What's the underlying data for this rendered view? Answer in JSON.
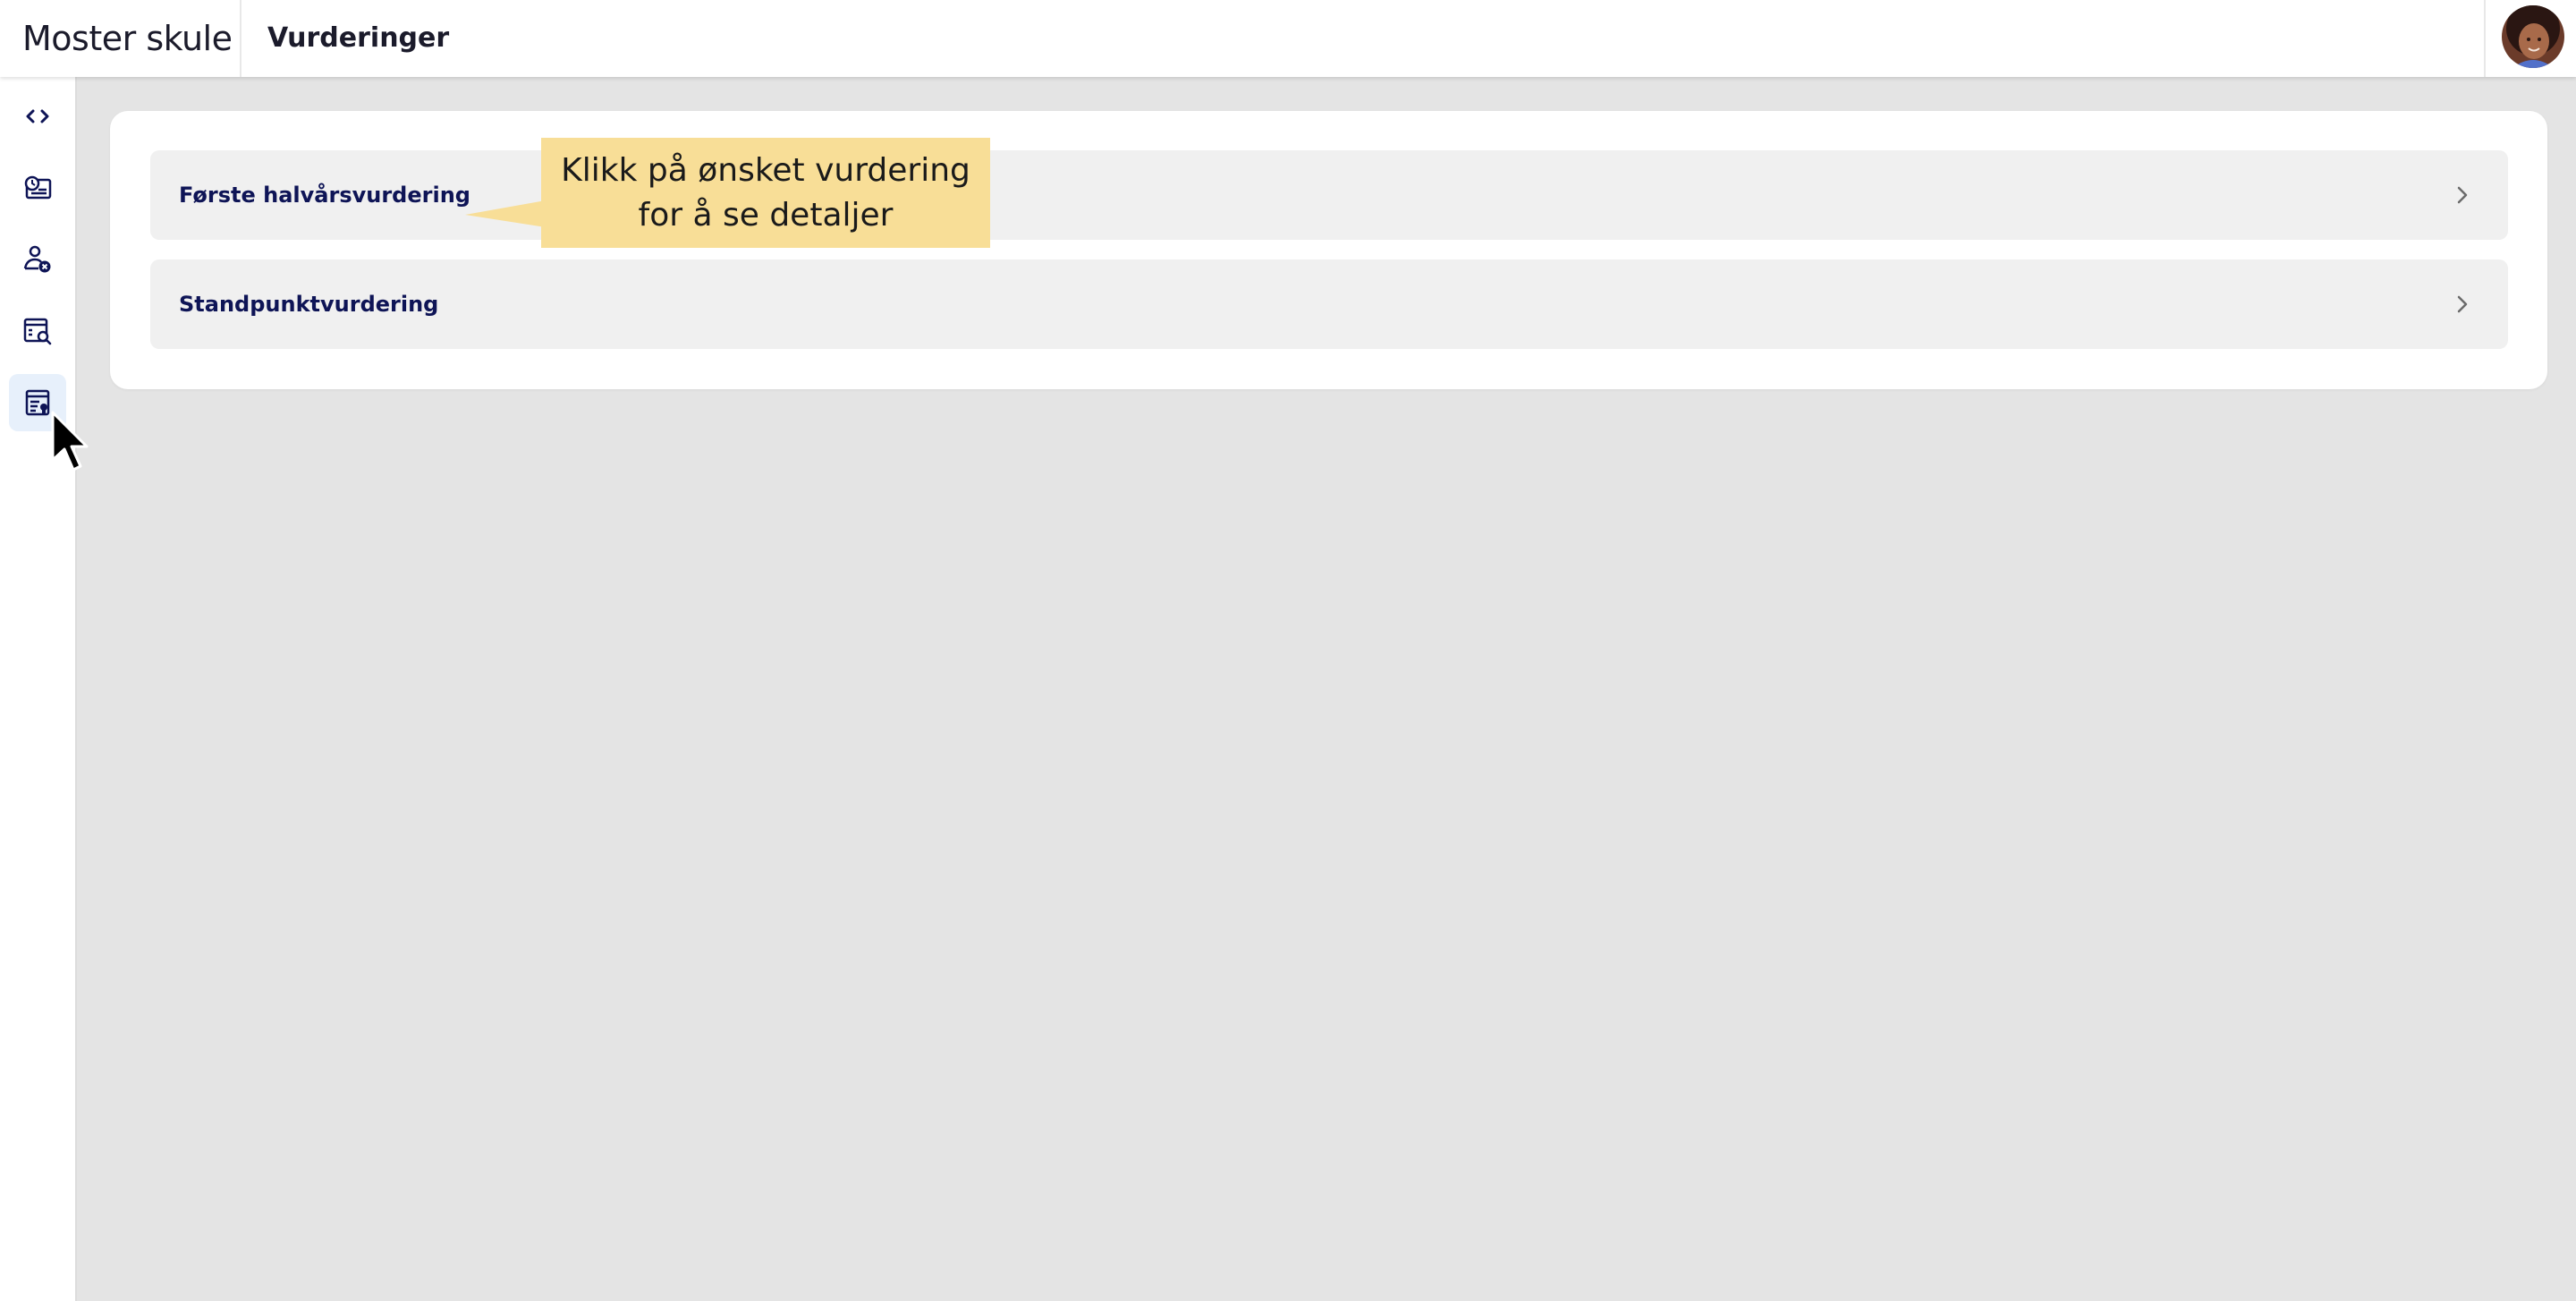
{
  "header": {
    "brand": "Moster skule",
    "title": "Vurderinger"
  },
  "sidebar": {
    "items": [
      {
        "icon": "expand-collapse-icon"
      },
      {
        "icon": "dashboard-icon"
      },
      {
        "icon": "user-absence-icon"
      },
      {
        "icon": "search-report-icon"
      },
      {
        "icon": "assessment-certificate-icon",
        "active": true
      }
    ]
  },
  "assessments": [
    {
      "label": "Første halvårsvurdering"
    },
    {
      "label": "Standpunktvurdering"
    }
  ],
  "callout": {
    "line1": "Klikk på ønsket vurdering",
    "line2": "for å se detaljer"
  },
  "colors": {
    "accent_navy": "#0e1456",
    "callout_bg": "#f8de97",
    "active_nav_bg": "#e7f0fb",
    "page_bg": "#e4e4e4"
  }
}
